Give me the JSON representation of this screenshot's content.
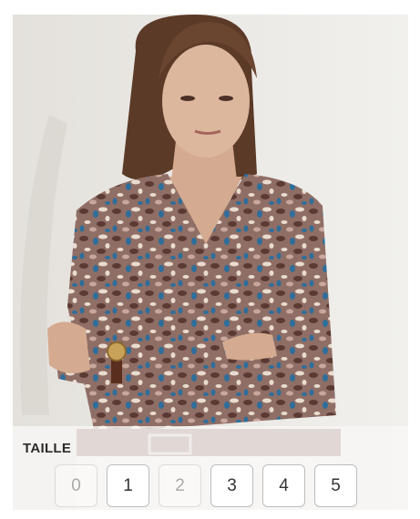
{
  "size_selector": {
    "title": "TAILLE",
    "sizes": [
      {
        "label": "0",
        "available": false
      },
      {
        "label": "1",
        "available": true
      },
      {
        "label": "2",
        "available": false
      },
      {
        "label": "3",
        "available": true
      },
      {
        "label": "4",
        "available": true
      },
      {
        "label": "5",
        "available": true
      }
    ]
  },
  "colors": {
    "background": "#ebe9e5",
    "sweater": "#8b6a63",
    "print_blue": "#2f6e9a",
    "print_brown": "#5a3a33",
    "hair": "#5b3a27",
    "skin": "#d9b59b"
  }
}
